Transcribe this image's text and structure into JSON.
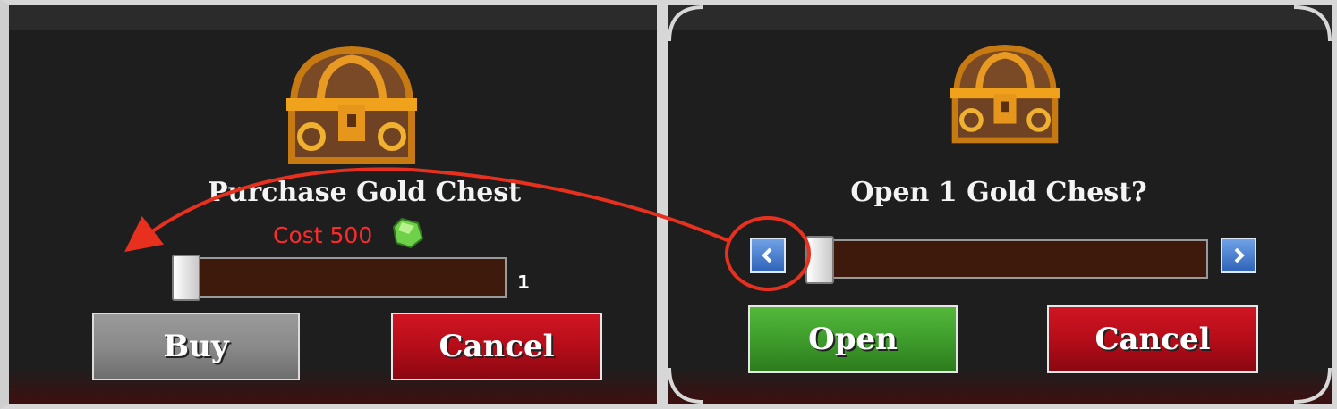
{
  "purchase_dialog": {
    "title": "Purchase Gold Chest",
    "cost_label": "Cost 500",
    "currency_icon": "green-gem-icon",
    "quantity": "1",
    "slider_fraction": 0,
    "buy_label": "Buy",
    "cancel_label": "Cancel"
  },
  "open_dialog": {
    "title": "Open 1 Gold Chest?",
    "slider_fraction": 0,
    "decrease_icon": "chevron-left-icon",
    "increase_icon": "chevron-right-icon",
    "open_label": "Open",
    "cancel_label": "Cancel"
  },
  "colors": {
    "cost_text": "#ff2a2a",
    "annotation": "#e8301f",
    "buy_button": "#8a8a8a",
    "cancel_button": "#b50d19",
    "open_button": "#3f9d2c"
  }
}
